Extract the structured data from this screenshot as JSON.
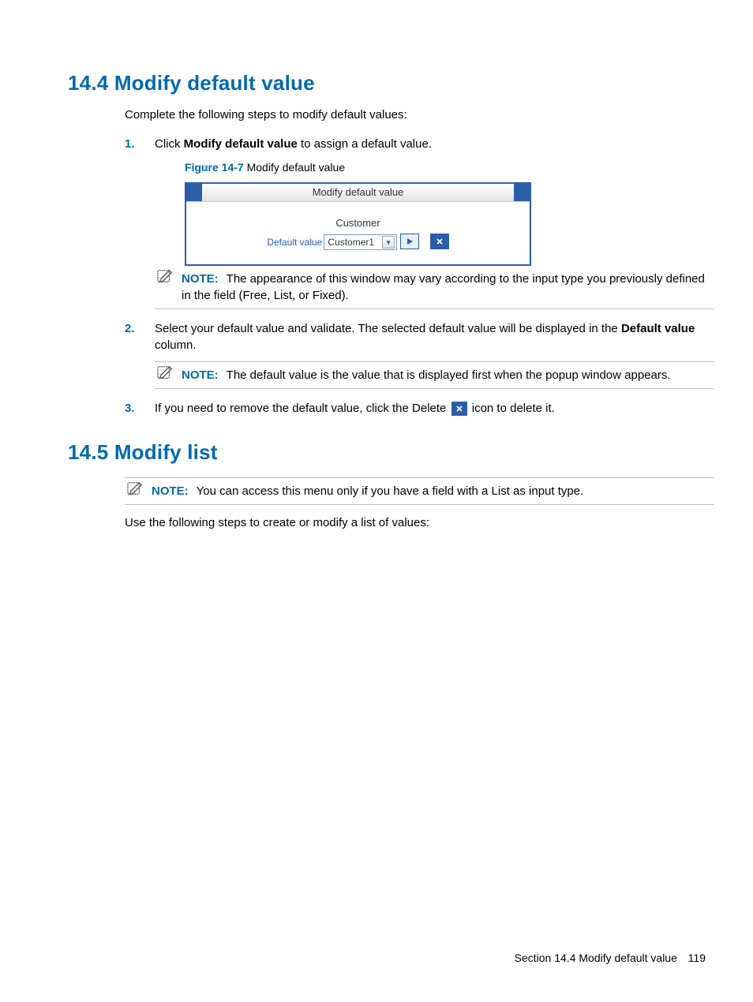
{
  "section1": {
    "heading": "14.4 Modify default value",
    "intro": "Complete the following steps to modify default values:",
    "steps": {
      "s1": {
        "num": "1.",
        "pre": "Click ",
        "bold": "Modify default value",
        "post": " to assign a default value."
      },
      "s2": {
        "num": "2.",
        "pre": "Select your default value and validate. The selected default value will be displayed in the ",
        "bold": "Default value",
        "post": " column."
      },
      "s3": {
        "num": "3.",
        "pre": "If you need to remove the default value, click the Delete ",
        "post": " icon to delete it."
      }
    },
    "figure": {
      "label": "Figure 14-7",
      "caption": "  Modify default value",
      "window_title": "Modify default value",
      "group_label": "Customer",
      "field_label": "Default value",
      "select_value": "Customer1"
    },
    "note1": {
      "label": "NOTE:",
      "text": "The appearance of this window may vary according to the input type you previously defined in the field (Free, List, or Fixed)."
    },
    "note2": {
      "label": "NOTE:",
      "text": "The default value is the value that is displayed first when the popup window appears."
    }
  },
  "section2": {
    "heading": "14.5 Modify list",
    "note": {
      "label": "NOTE:",
      "text": "You can access this menu only if you have a field with a List as input type."
    },
    "intro": "Use the following steps to create or modify a list of values:"
  },
  "footer": {
    "section_label": "Section 14.4  Modify default value",
    "page": "119"
  }
}
